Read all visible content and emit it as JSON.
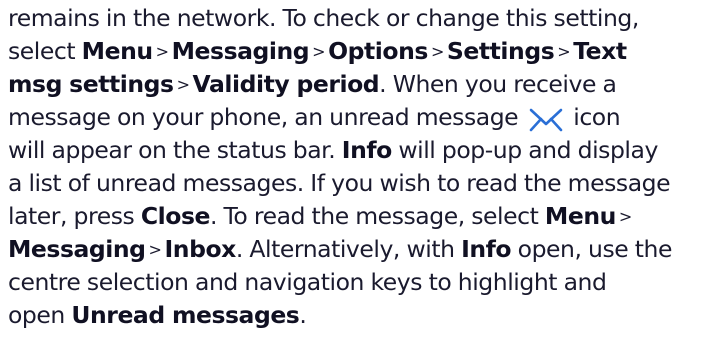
{
  "lines": [
    {
      "t1": "remains in the network. To check or change this setting,"
    },
    {
      "t1": "select",
      "b1": "Menu",
      "s1": ">",
      "b2": "Messaging",
      "s2": ">",
      "b3": "Options",
      "s3": ">",
      "b4": "Settings",
      "s4": ">",
      "b5": "Text"
    },
    {
      "b1": "msg settings",
      "s1": ">",
      "b2": "Validity period",
      "t1": ". When you receive a"
    },
    {
      "t1": "message on your phone, an unread message",
      "t2": "icon"
    },
    {
      "t1": "will appear on the status bar.",
      "b1": "Info",
      "t2": "will pop-up and display"
    },
    {
      "t1": "a list of unread messages. If you wish to read the message"
    },
    {
      "t1": "later, press",
      "b1": "Close",
      "t2": ". To read the message, select",
      "b2": "Menu",
      "s1": ">"
    },
    {
      "b1": "Messaging",
      "s1": ">",
      "b2": "Inbox",
      "t1": ". Alternatively, with",
      "b3": "Info",
      "t2": "open, use the"
    },
    {
      "t1": "centre selection and navigation keys to highlight and"
    },
    {
      "t1": "open",
      "b1": "Unread messages",
      "t2": "."
    }
  ],
  "icon": "envelope-icon",
  "colors": {
    "text": "#1a1a2e",
    "icon": "#2a6fd6"
  }
}
